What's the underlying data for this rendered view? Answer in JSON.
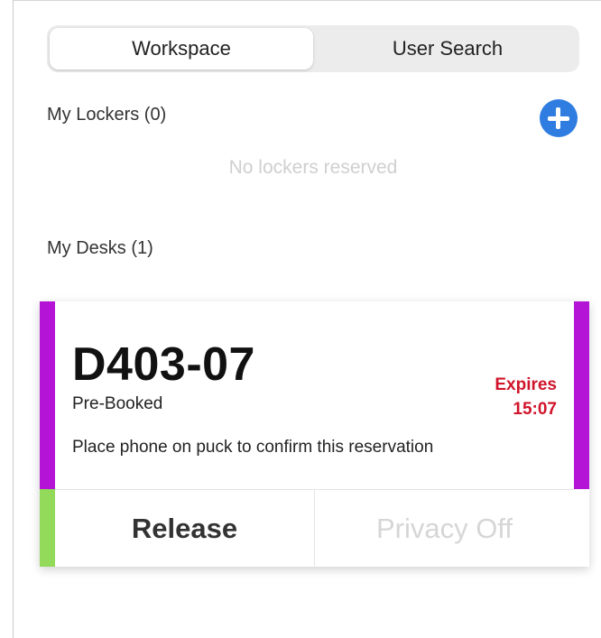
{
  "tabs": [
    {
      "label": "Workspace",
      "active": true
    },
    {
      "label": "User Search",
      "active": false
    }
  ],
  "lockers": {
    "heading": "My Lockers (0)",
    "add_icon": "plus-circle-icon",
    "empty_text": "No lockers reserved"
  },
  "desks": {
    "heading": "My Desks (1)",
    "items": [
      {
        "id": "D403-07",
        "status": "Pre-Booked",
        "expires_label": "Expires",
        "expires_time": "15:07",
        "instruction": "Place phone on puck to confirm this reservation",
        "actions": {
          "release": "Release",
          "privacy": "Privacy Off"
        }
      }
    ]
  },
  "colors": {
    "accent_blue": "#2f7de1",
    "booking_purple": "#b414d6",
    "release_green": "#93d95a",
    "expires_red": "#d0142a"
  }
}
